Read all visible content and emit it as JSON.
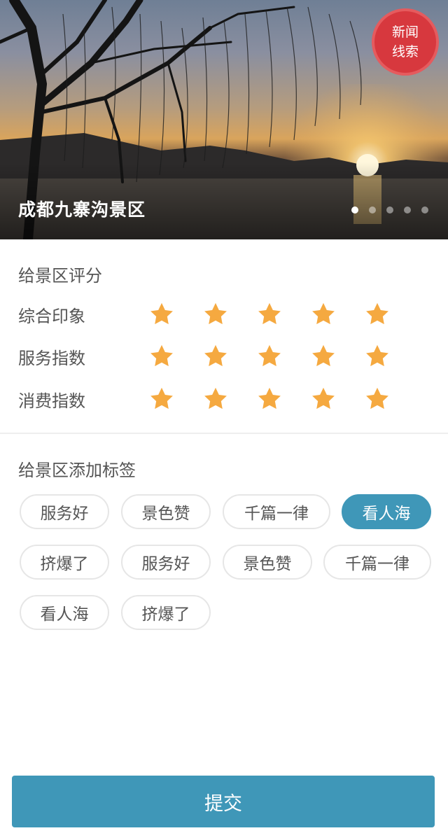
{
  "hero": {
    "title": "成都九寨沟景区",
    "badge_line1": "新闻",
    "badge_line2": "线索",
    "slide_count": 5,
    "active_slide": 1
  },
  "rating": {
    "title": "给景区评分",
    "rows": [
      {
        "label": "综合印象",
        "stars": 5
      },
      {
        "label": "服务指数",
        "stars": 5
      },
      {
        "label": "消费指数",
        "stars": 5
      }
    ],
    "star_color": "#f5a940"
  },
  "tags": {
    "title": "给景区添加标签",
    "items": [
      {
        "label": "服务好",
        "selected": false
      },
      {
        "label": "景色赞",
        "selected": false
      },
      {
        "label": "千篇一律",
        "selected": false
      },
      {
        "label": "看人海",
        "selected": true
      },
      {
        "label": "挤爆了",
        "selected": false
      },
      {
        "label": "服务好",
        "selected": false
      },
      {
        "label": "景色赞",
        "selected": false
      },
      {
        "label": "千篇一律",
        "selected": false
      },
      {
        "label": "看人海",
        "selected": false
      },
      {
        "label": "挤爆了",
        "selected": false
      }
    ],
    "accent": "#3f97b8"
  },
  "submit_label": "提交"
}
